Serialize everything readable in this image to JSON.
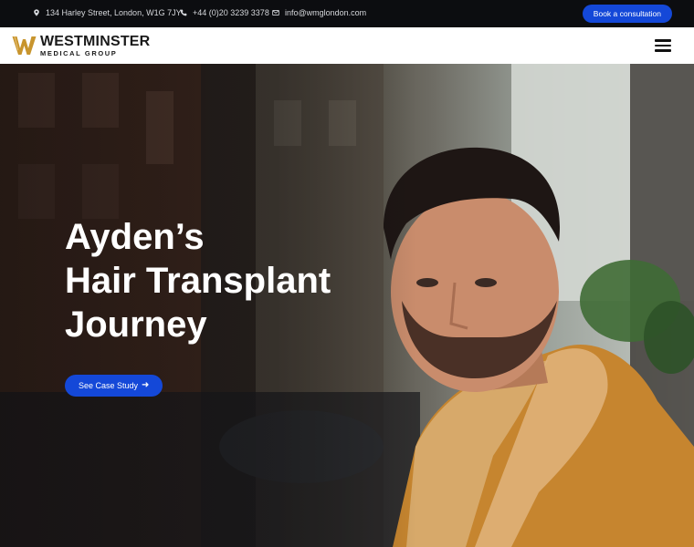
{
  "topbar": {
    "address": "134 Harley Street, London, W1G 7JY",
    "phone": "+44 (0)20 3239 3378",
    "email": "info@wmglondon.com",
    "cta_label": "Book a consultation",
    "cta_color": "#1448d8"
  },
  "header": {
    "logo_line1": "WESTMINSTER",
    "logo_line2": "MEDICAL GROUP",
    "logo_color": "#c8952e",
    "menu_icon": "hamburger-icon"
  },
  "hero": {
    "title_line1": "Ayden’s",
    "title_line2": "Hair Transplant",
    "title_line3": "Journey",
    "button_label": "See Case Study",
    "button_icon": "arrow-right-icon",
    "button_color": "#1448d8"
  }
}
